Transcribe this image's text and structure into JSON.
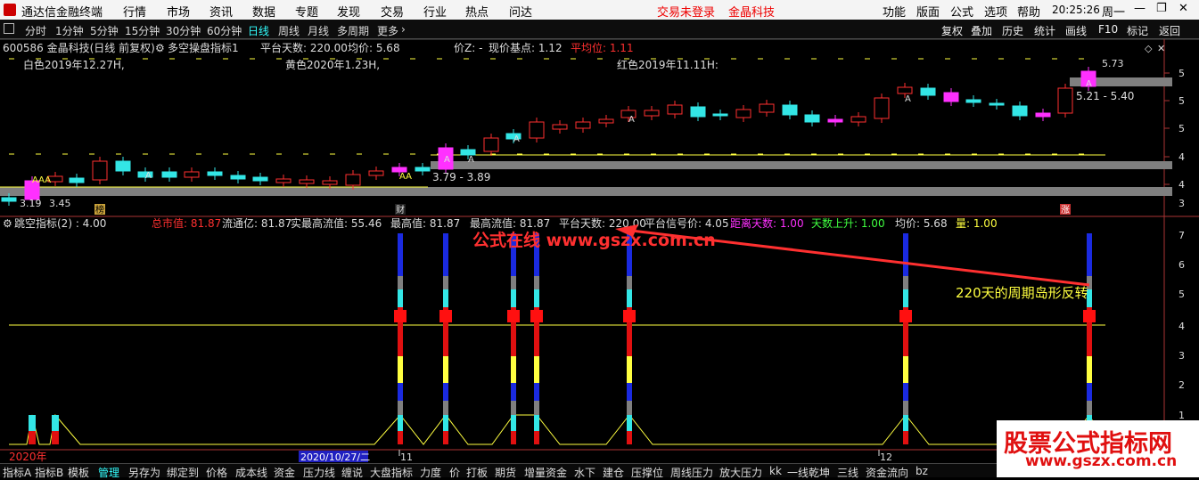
{
  "titlebar": {
    "app_name": "通达信金融终端",
    "menu": [
      "行情",
      "市场",
      "资讯",
      "数据",
      "专题",
      "发现",
      "交易",
      "行业",
      "热点",
      "问达"
    ],
    "login_status": "交易未登录",
    "stock_name": "金晶科技",
    "right_menu": [
      "功能",
      "版面",
      "公式",
      "选项",
      "帮助"
    ],
    "clock": "20:25:26",
    "weekday": "周一"
  },
  "toolbar": {
    "timeframes": [
      "分时",
      "1分钟",
      "5分钟",
      "15分钟",
      "30分钟",
      "60分钟",
      "日线",
      "周线",
      "月线",
      "多周期",
      "更多"
    ],
    "active": "日线",
    "right_buttons": [
      "复权",
      "叠加",
      "历史",
      "统计",
      "画线",
      "F10",
      "标记",
      "返回"
    ]
  },
  "main_header": {
    "stock": "600586 金晶科技(日线 前复权)",
    "indicator": "多空操盘指标1",
    "platform_days": "平台天数: 220.00",
    "avg_price": "均价: 5.68",
    "price_z": "价Z: -",
    "base_point": "现价基点: 1.12",
    "avg_level": "平均位: 1.11"
  },
  "main_labels": {
    "white": "白色2019年12.27H,",
    "yellow": "黄色2020年1.23H,",
    "red": "红色2019年11.11H:",
    "band_low": "3.79 - 3.89",
    "band_high": "5.21 - 5.40",
    "last_price": "5.73",
    "start_low": "3.19",
    "start_low2": "3.45",
    "marker_a": "A",
    "marker_aaa": "AAA",
    "marker_aa": "AA",
    "tag_bang": "榜",
    "tag_cai": "财",
    "tag_zhang": "涨"
  },
  "price_axis": [
    "5",
    "5",
    "5",
    "4",
    "4",
    "3",
    "3"
  ],
  "sub_header": {
    "indicator": "跳空指标(2) : 4.00",
    "total_mv": "总市值: 81.87",
    "float_mv": "流通亿: 81.87",
    "real_float": "实最高流值: 55.46",
    "highest": "最高值: 81.87",
    "highest_float": "最高流值: 81.87",
    "platform_days": "平台天数: 220.00",
    "signal_price": "平台信号价: 4.05",
    "distance_days": "距离天数: 1.00",
    "days_up": "天数上升: 1.00",
    "avg_price": "均价: 5.68",
    "volume": "量: 1.00"
  },
  "sub_axis": [
    "7",
    "6",
    "5",
    "4",
    "3",
    "2",
    "1"
  ],
  "annotation": {
    "watermark_red": "公式在线 www.gszx.com.cn",
    "note": "220天的周期岛形反转"
  },
  "date_axis": {
    "year": "2020年",
    "cursor_date": "2020/10/27/二",
    "m11": "11",
    "m12": "12"
  },
  "bottombar": [
    "指标A",
    "指标B",
    "模板",
    "管理",
    "另存为",
    "绑定到",
    "价格",
    "成本线",
    "资金",
    "压力线",
    "缠说",
    "大盘指标",
    "力度",
    "价",
    "打板",
    "期货",
    "增量资金",
    "水下",
    "建仓",
    "压撑位",
    "周线压力",
    "放大压力",
    "kk",
    "一线乾坤",
    "三线",
    "资金流向",
    "bz"
  ],
  "corner_watermark": {
    "line1": "股票公式指标网",
    "line2": "www.gszx.com.cn"
  },
  "colors": {
    "up": "#ff3030",
    "down": "#33e6e6",
    "magenta": "#ff30ff",
    "yellow": "#ffff40",
    "band": "#7f7f7f"
  }
}
